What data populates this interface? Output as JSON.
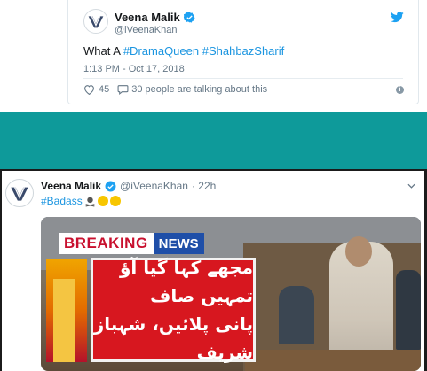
{
  "embedded_tweet": {
    "display_name": "Veena Malik",
    "handle": "@iVeenaKhan",
    "text_prefix": "What A",
    "hashtags": [
      "#DramaQueen",
      "#ShahbazSharif"
    ],
    "timestamp": "1:13 PM - Oct 17, 2018",
    "likes": "45",
    "talking": "30 people are talking about this",
    "info_icon": "i"
  },
  "screenshot_tweet": {
    "display_name": "Veena Malik",
    "handle": "@iVeenaKhan",
    "age": "· 22h",
    "text": "#Badass"
  },
  "media": {
    "breaking": "BREAKING",
    "news": "NEWS",
    "urdu_line_1": "مجھے کہا گیا آؤ تمہیں صاف",
    "urdu_line_2": "پانی پلائیں، شہباز شریف"
  },
  "colors": {
    "link": "#1b95e0",
    "teal": "#0e9a9a",
    "twitter_blue": "#1da1f2",
    "breaking_red": "#c8102e"
  },
  "icons": {
    "verified": "verified-badge-icon",
    "bird": "twitter-bird-icon",
    "heart": "heart-icon",
    "reply": "speech-bubble-icon",
    "chevron": "chevron-down-icon"
  }
}
